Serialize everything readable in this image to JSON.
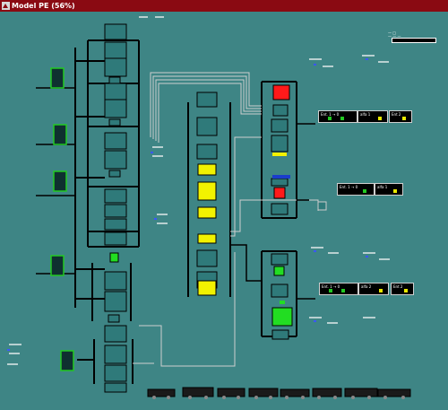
{
  "window": {
    "title": "Model PE (56%)"
  },
  "top_status": {
    "line1": "— □",
    "line2": "— — —"
  },
  "legends": [
    {
      "label": "Ent. 1 → 0",
      "color": "#22c922"
    },
    {
      "label": "alfa 1",
      "color": "#e8e800"
    },
    {
      "label": "Ent 2",
      "color": "#e8e800"
    },
    {
      "label": "Ent. 1 → 0",
      "color": "#22c922"
    },
    {
      "label": "alfa 1",
      "color": "#e8e800"
    },
    {
      "label": "Ent. 1 → 0",
      "color": "#22c922"
    },
    {
      "label": "alfa 2",
      "color": "#e8e800"
    },
    {
      "label": "Ent 2",
      "color": "#e8e800"
    }
  ],
  "colors": {
    "bg": "#3e8585",
    "line": "#000000",
    "node": "#2f7a7a",
    "red": "#ff1a1a",
    "yellow": "#f2f200",
    "green": "#22dd22",
    "blue": "#1a3dcc"
  }
}
